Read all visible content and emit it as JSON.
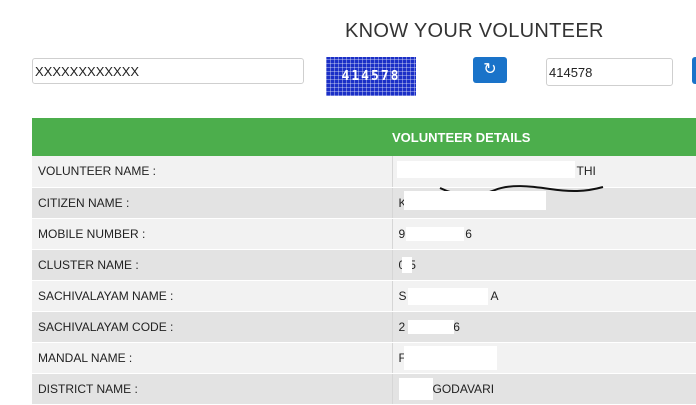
{
  "header": {
    "title": "KNOW YOUR VOLUNTEER"
  },
  "search": {
    "aadhaar_value": "XXXXXXXXXXXX",
    "captcha_text": "414578",
    "captcha_value": "414578",
    "refresh_icon": "refresh-icon"
  },
  "details": {
    "heading": "VOLUNTEER DETAILS",
    "rows": [
      {
        "label": "VOLUNTEER NAME :",
        "value_prefix": "",
        "value_suffix": "THI"
      },
      {
        "label": "CITIZEN NAME :",
        "value_prefix": "K",
        "value_suffix": ""
      },
      {
        "label": "MOBILE NUMBER :",
        "value_prefix": "9",
        "value_suffix": "6"
      },
      {
        "label": "CLUSTER NAME :",
        "value_prefix": "0",
        "value_suffix": "5"
      },
      {
        "label": "SACHIVALAYAM NAME :",
        "value_prefix": "S",
        "value_suffix": "A"
      },
      {
        "label": "SACHIVALAYAM CODE :",
        "value_prefix": "2",
        "value_suffix": "6"
      },
      {
        "label": "MANDAL NAME :",
        "value_prefix": "F",
        "value_suffix": ""
      },
      {
        "label": "DISTRICT NAME :",
        "value_prefix": "",
        "value_suffix": "GODAVARI"
      }
    ]
  },
  "colors": {
    "header_green": "#4cae4c",
    "button_blue": "#1a73c9",
    "captcha_blue": "#1b2fc7"
  }
}
